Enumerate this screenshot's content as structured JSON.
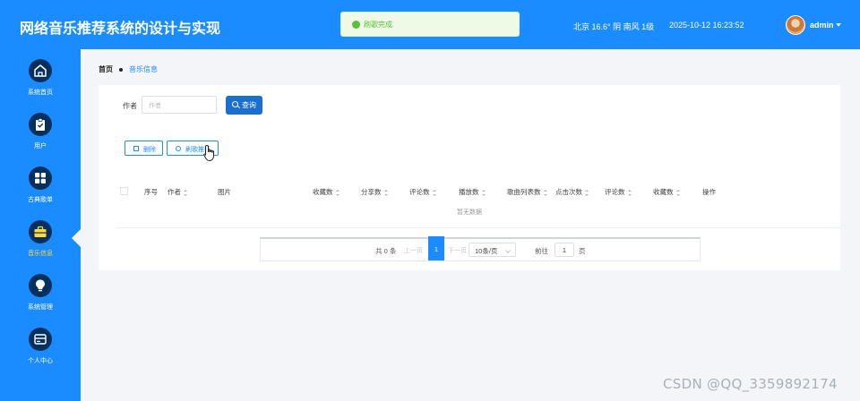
{
  "header": {
    "title": "网络音乐推荐系统的设计与实现",
    "toast": "刷歌完成",
    "weather": "北京 16.6° 阴 南风 1级",
    "datetime": "2025-10-12 16:23:52",
    "username": "admin"
  },
  "sidebar": {
    "items": [
      {
        "label": "系统首页",
        "icon": "home-icon"
      },
      {
        "label": "用户",
        "icon": "clipboard-icon"
      },
      {
        "label": "古典歌单",
        "icon": "grid-icon"
      },
      {
        "label": "音乐信息",
        "icon": "briefcase-icon",
        "active": true
      },
      {
        "label": "系统管理",
        "icon": "bulb-icon"
      },
      {
        "label": "个人中心",
        "icon": "card-icon"
      }
    ]
  },
  "breadcrumb": {
    "home": "首页",
    "current": "音乐信息"
  },
  "filter": {
    "label": "作者",
    "placeholder": "作者",
    "query_label": "查询"
  },
  "actions": {
    "delete_label": "删除",
    "recommend_label": "刷歌推荐"
  },
  "table": {
    "columns": [
      "序号",
      "作者",
      "图片",
      "收藏数",
      "分享数",
      "评论数",
      "播放数",
      "歌曲列表数",
      "点击次数",
      "评论数",
      "收藏数",
      "操作"
    ],
    "empty_text": "暂无数据"
  },
  "pagination": {
    "total": "共 0 条",
    "prev": "上一页",
    "current_page": "1",
    "next": "下一页",
    "page_size": "10条/页",
    "goto_label": "前往",
    "goto_value": "1",
    "page_unit": "页"
  },
  "watermark": "CSDN @QQ_3359892174",
  "colors": {
    "primary": "#1a8cff",
    "sidebar_icon_bg": "#05305e",
    "active_label": "#ffd93d",
    "success": "#5bbf3a"
  }
}
